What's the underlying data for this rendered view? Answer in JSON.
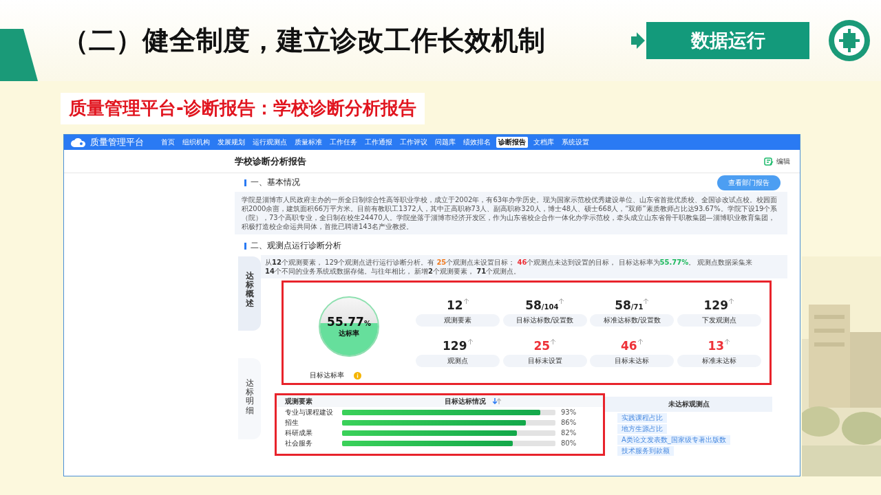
{
  "slide": {
    "title": "（二）健全制度，建立诊改工作长效机制",
    "badge": "数据运行",
    "subtitle": "质量管理平台-诊断报告：学校诊断分析报告"
  },
  "app": {
    "brand": "质量管理平台",
    "nav": [
      {
        "label": "首页",
        "selected": false
      },
      {
        "label": "组织机构",
        "selected": false
      },
      {
        "label": "发展规划",
        "selected": false
      },
      {
        "label": "运行观测点",
        "selected": false
      },
      {
        "label": "质量标准",
        "selected": false
      },
      {
        "label": "工作任务",
        "selected": false
      },
      {
        "label": "工作通报",
        "selected": false
      },
      {
        "label": "工作评议",
        "selected": false
      },
      {
        "label": "问题库",
        "selected": false
      },
      {
        "label": "绩效排名",
        "selected": false
      },
      {
        "label": "诊断报告",
        "selected": true
      },
      {
        "label": "文档库",
        "selected": false
      },
      {
        "label": "系统设置",
        "selected": false
      }
    ],
    "page_title": "学校诊断分析报告",
    "edit_label": "编辑",
    "section_1": {
      "title": "一、基本情况",
      "button": "查看部门报告",
      "text": "学院是淄博市人民政府主办的一所全日制综合性高等职业学校，成立于2002年，有63年办学历史。现为国家示范校优秀建设单位、山东省首批优质校、全国诊改试点校。校园面积2000余亩，建筑面积66万平方米。目前有教职工1372人，其中正高职称73人、副高职称320人，博士48人、硕士668人，“双师”素质教师占比达93.67%。学院下设19个系（院），73个高职专业，全日制在校生24470人。学院坐落于淄博市经济开发区，作为山东省校企合作一体化办学示范校，牵头成立山东省骨干职教集团—淄博职业教育集团，积极打造校企命运共同体，首批已聘请143名产业教授。"
    },
    "section_2": {
      "title": "二、观测点运行诊断分析",
      "side_tabs": [
        {
          "label": "达标概述",
          "selected": true
        },
        {
          "label": "达标明细",
          "selected": false
        }
      ],
      "summary": [
        [
          {
            "kind": "plain",
            "text": "从"
          },
          {
            "kind": "bold",
            "text": "12"
          },
          {
            "kind": "plain",
            "text": "个观测要素， 129个观测点进行运行诊断分析。有 "
          },
          {
            "kind": "orange",
            "text": "25"
          },
          {
            "kind": "plain",
            "text": "个观测点未设置目标； "
          },
          {
            "kind": "red",
            "text": "46"
          },
          {
            "kind": "plain",
            "text": "个观测点未达到设置的目标， 目标达标率为"
          },
          {
            "kind": "green",
            "text": "55.77%"
          },
          {
            "kind": "plain",
            "text": "。 观测点数据采集来"
          }
        ],
        [
          {
            "kind": "bold",
            "text": "14"
          },
          {
            "kind": "plain",
            "text": "个不同的业务系统或数据存储。与往年相比， 新增"
          },
          {
            "kind": "bold",
            "text": "2"
          },
          {
            "kind": "plain",
            "text": "个观测要素， "
          },
          {
            "kind": "bold",
            "text": "71"
          },
          {
            "kind": "plain",
            "text": "个观测点。"
          }
        ]
      ],
      "gauge": {
        "value": "55.77",
        "unit": "%",
        "caption": "达标率",
        "label": "目标达标率"
      },
      "stats": [
        {
          "value": "12",
          "alert": false,
          "label": "观测要素"
        },
        {
          "value": "58",
          "total": "/104",
          "alert": false,
          "label": "目标达标数/设置数"
        },
        {
          "value": "58",
          "total": "/71",
          "alert": false,
          "label": "标准达标数/设置数"
        },
        {
          "value": "129",
          "alert": false,
          "label": "下发观测点"
        },
        {
          "value": "129",
          "alert": false,
          "label": "观测点"
        },
        {
          "value": "25",
          "alert": true,
          "label": "目标未设置"
        },
        {
          "value": "46",
          "alert": true,
          "label": "目标未达标"
        },
        {
          "value": "13",
          "alert": true,
          "label": "标准未达标"
        }
      ],
      "table": {
        "columns": [
          "观测要素",
          "目标达标情况"
        ],
        "rows": [
          {
            "name": "专业与课程建设",
            "level": 0.93,
            "reading": "93%"
          },
          {
            "name": "招生",
            "level": 0.86,
            "reading": "86%"
          },
          {
            "name": "科研成果",
            "level": 0.82,
            "reading": "82%"
          },
          {
            "name": "社会服务",
            "level": 0.8,
            "reading": "80%"
          }
        ]
      },
      "unmet": {
        "title": "未达标观测点",
        "items": [
          "实践课程占比",
          "地方生源占比",
          "A类论文发表数_国家级专著出版数",
          "技术服务到款额"
        ]
      }
    }
  }
}
